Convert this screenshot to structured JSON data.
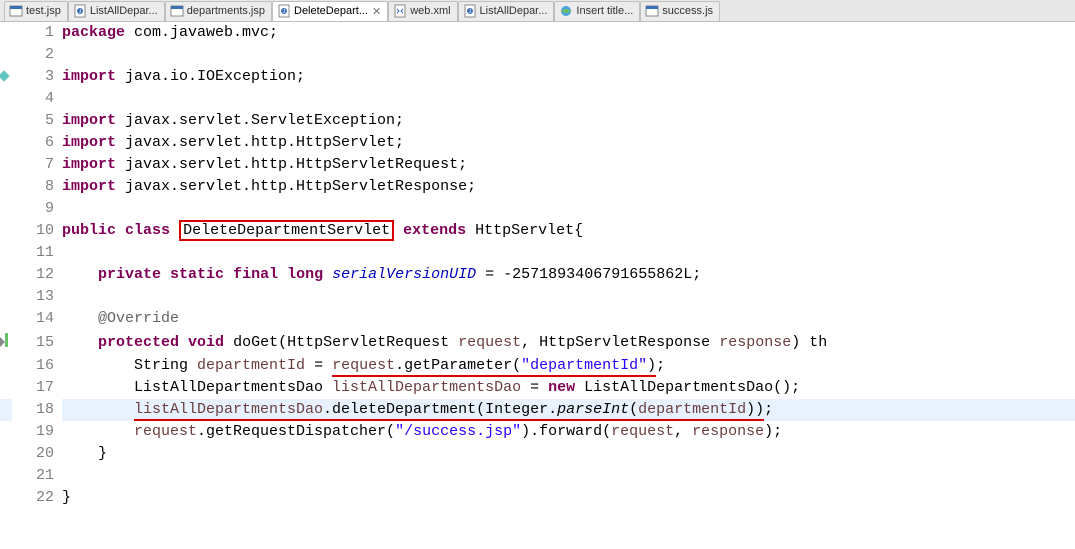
{
  "tabs": [
    {
      "label": "test.jsp",
      "icon": "jsp",
      "active": false
    },
    {
      "label": "ListAllDepar...",
      "icon": "java",
      "active": false
    },
    {
      "label": "departments.jsp",
      "icon": "jsp",
      "active": false
    },
    {
      "label": "DeleteDepart...",
      "icon": "java",
      "active": true,
      "dirty": true
    },
    {
      "label": "web.xml",
      "icon": "xml",
      "active": false
    },
    {
      "label": "ListAllDepar...",
      "icon": "java",
      "active": false
    },
    {
      "label": "Insert title...",
      "icon": "web",
      "active": false
    },
    {
      "label": "success.js",
      "icon": "jsp",
      "active": false
    }
  ],
  "code": {
    "package_kw": "package",
    "package_name": " com.javaweb.mvc;",
    "import_kw": "import",
    "import1": " java.io.IOException;",
    "import2": " javax.servlet.ServletException;",
    "import3": " javax.servlet.http.HttpServlet;",
    "import4": " javax.servlet.http.HttpServletRequest;",
    "import5": " javax.servlet.http.HttpServletResponse;",
    "public_kw": "public",
    "class_kw": "class",
    "class_name": "DeleteDepartmentServlet",
    "extends_kw": "extends",
    "superclass": " HttpServlet{",
    "private_kw": "private",
    "static_kw": "static",
    "final_kw": "final",
    "long_kw": "long",
    "serial_field": "serialVersionUID",
    "serial_val": " = -2571893406791655862L;",
    "override_ann": "@Override",
    "protected_kw": "protected",
    "void_kw": "void",
    "doGet": "doGet",
    "req_type": "HttpServletRequest ",
    "req_param": "request",
    "resp_type": ", HttpServletResponse ",
    "resp_param": "response",
    "throws_tail": ") th",
    "line16_pre": "        String ",
    "dep_id_var": "departmentId",
    "line16_eq": " = ",
    "line16_call_a": "request",
    "line16_call_b": ".getParameter(",
    "line16_str": "\"departmentId\"",
    "line16_end": ")",
    "line16_semi": ";",
    "line17_pre": "        ListAllDepartmentsDao ",
    "dao_var": "listAllDepartmentsDao",
    "line17_eq": " = ",
    "new_kw": "new",
    "line17_tail": " ListAllDepartmentsDao();",
    "line18_pre": "        ",
    "line18_a": "listAllDepartmentsDao",
    "line18_b": ".deleteDepartment(Integer.",
    "line18_parse": "parseInt",
    "line18_c": "(",
    "line18_d": "departmentId",
    "line18_e": "))",
    "line18_semi": ";",
    "line19_pre": "        ",
    "line19_a": "request",
    "line19_b": ".getRequestDispatcher(",
    "line19_str": "\"/success.jsp\"",
    "line19_c": ").forward(",
    "line19_d": "request",
    "line19_e": ", ",
    "line19_f": "response",
    "line19_g": ");",
    "line20": "    }",
    "brace_close": "}"
  },
  "line_numbers": [
    "1",
    "2",
    "3",
    "4",
    "5",
    "6",
    "7",
    "8",
    "9",
    "10",
    "11",
    "12",
    "13",
    "14",
    "15",
    "16",
    "17",
    "18",
    "19",
    "20",
    "21",
    "22"
  ]
}
